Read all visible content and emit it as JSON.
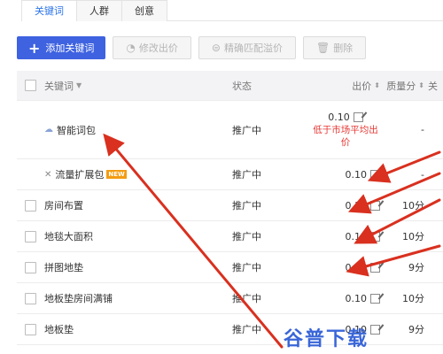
{
  "tabs": [
    {
      "label": "关键词",
      "active": true
    },
    {
      "label": "人群",
      "active": false
    },
    {
      "label": "创意",
      "active": false
    }
  ],
  "toolbar": {
    "add_label": "添加关键词",
    "edit_bid_label": "修改出价",
    "precise_label": "精确匹配溢价",
    "delete_label": "删除"
  },
  "table": {
    "headers": {
      "keyword": "关键词",
      "status": "状态",
      "bid": "出价",
      "quality": "质量分",
      "last": "关"
    },
    "rows": [
      {
        "keyword": "智能词包",
        "status": "推广中",
        "bid": "0.10",
        "warning": "低于市场平均出价",
        "quality": "-",
        "icon": "cloud"
      },
      {
        "keyword": "流量扩展包",
        "badge": "NEW",
        "status": "推广中",
        "bid": "0.10",
        "quality": "-",
        "icon": "expand"
      },
      {
        "keyword": "房间布置",
        "status": "推广中",
        "bid": "0.10",
        "quality": "10分"
      },
      {
        "keyword": "地毯大面积",
        "status": "推广中",
        "bid": "0.10",
        "quality": "10分"
      },
      {
        "keyword": "拼图地垫",
        "status": "推广中",
        "bid": "0.10",
        "quality": "9分"
      },
      {
        "keyword": "地板垫房间满铺",
        "status": "推广中",
        "bid": "0.10",
        "quality": "10分"
      },
      {
        "keyword": "地板垫",
        "status": "推广中",
        "bid": "0.10",
        "quality": "9分"
      }
    ]
  },
  "watermark": "谷普下载",
  "colors": {
    "primary": "#3e62e0",
    "arrow": "#d9301f",
    "warning": "#e53935"
  }
}
